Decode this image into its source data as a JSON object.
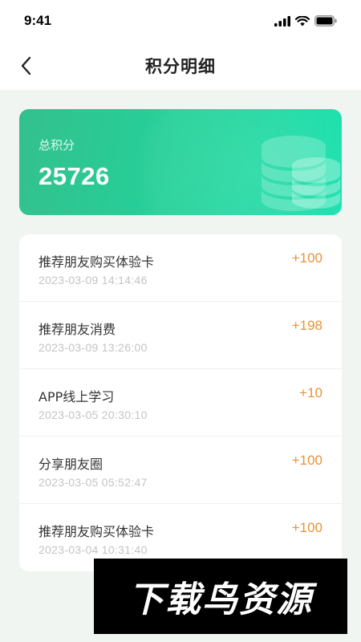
{
  "status_bar": {
    "time": "9:41"
  },
  "nav": {
    "title": "积分明细",
    "back_icon": "chevron-left-icon"
  },
  "points_card": {
    "label": "总积分",
    "value": "25726",
    "colors": {
      "start": "#34c08e",
      "end": "#12e0ab"
    },
    "icon": "coin-stack-icon"
  },
  "records": [
    {
      "title": "推荐朋友购买体验卡",
      "time": "2023-03-09 14:14:46",
      "points": "+100"
    },
    {
      "title": "推荐朋友消费",
      "time": "2023-03-09 13:26:00",
      "points": "+198"
    },
    {
      "title": "APP线上学习",
      "time": "2023-03-05 20:30:10",
      "points": "+10"
    },
    {
      "title": "分享朋友圈",
      "time": "2023-03-05 05:52:47",
      "points": "+100"
    },
    {
      "title": "推荐朋友购买体验卡",
      "time": "2023-03-04 10:31:40",
      "points": "+100"
    }
  ],
  "watermark": {
    "text": "下载鸟资源"
  },
  "accent_colors": {
    "points": "#e8923a",
    "page_bg": "#f0f5f2"
  }
}
